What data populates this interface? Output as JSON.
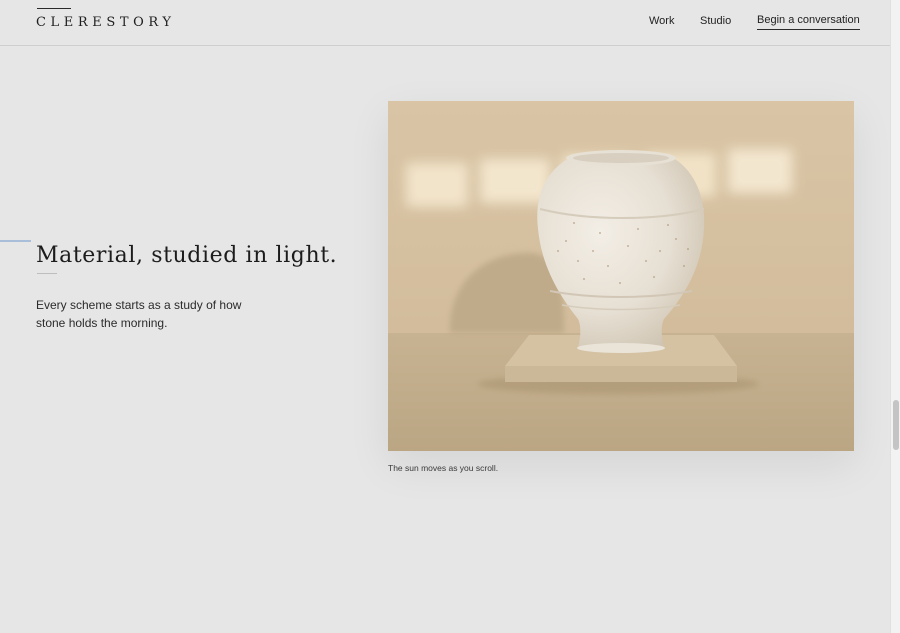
{
  "header": {
    "logo": "CLERESTORY",
    "nav": {
      "work": "Work",
      "studio": "Studio",
      "cta": "Begin a conversation"
    }
  },
  "section": {
    "headline": "Material, studied in light.",
    "body": "Every scheme starts as a study of how stone holds the morning."
  },
  "figure": {
    "caption": "The sun moves as you scroll."
  },
  "scrollbar": {
    "position_fraction": 0.66
  },
  "colors": {
    "background": "#e6e6e6",
    "accent": "#a9bfd9",
    "wall": "#dac6a8",
    "floor": "#c2ad8c",
    "vase": "#ece6dc"
  }
}
